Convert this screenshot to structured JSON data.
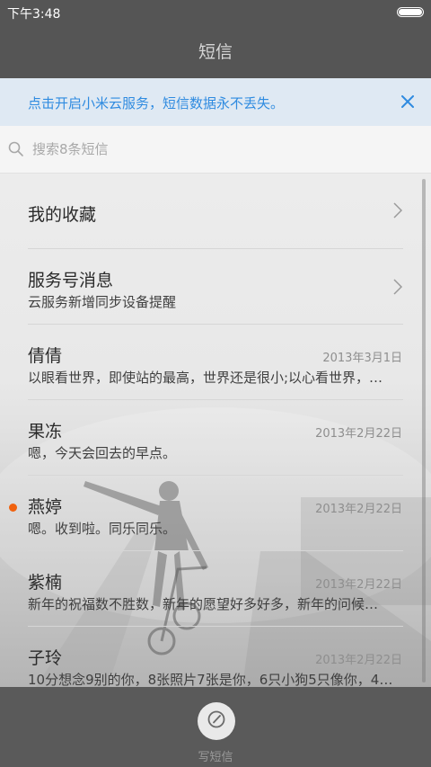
{
  "status_bar": {
    "time": "下午3:48"
  },
  "header": {
    "title": "短信"
  },
  "banner": {
    "text": "点击开启小米云服务，短信数据永不丢失。"
  },
  "search": {
    "placeholder": "搜索8条短信"
  },
  "list": {
    "items": [
      {
        "title": "我的收藏",
        "subtitle": "",
        "date": ""
      },
      {
        "title": "服务号消息",
        "subtitle": "云服务新增同步设备提醒",
        "date": ""
      },
      {
        "title": "倩倩",
        "subtitle": "以眼看世界，即使站的最高，世界还是很小;以心看世界，…",
        "date": "2013年3月1日"
      },
      {
        "title": "果冻",
        "subtitle": "嗯，今天会回去的早点。",
        "date": "2013年2月22日"
      },
      {
        "title": "燕婷",
        "subtitle": "嗯。收到啦。同乐同乐。",
        "date": "2013年2月22日"
      },
      {
        "title": "紫楠",
        "subtitle": "新年的祝福数不胜数，新年的愿望好多好多，新年的问候…",
        "date": "2013年2月22日"
      },
      {
        "title": "子玲",
        "subtitle": "10分想念9别的你，8张照片7张是你，6只小狗5只像你，4…",
        "date": "2013年2月22日"
      }
    ]
  },
  "bottom_bar": {
    "compose_label": "写短信"
  },
  "colors": {
    "accent": "#2f8be0",
    "unread": "#f0610e",
    "chrome": "#555555"
  },
  "icons": [
    "battery-icon",
    "close-icon",
    "search-icon",
    "chevron-right-icon",
    "compose-icon"
  ]
}
